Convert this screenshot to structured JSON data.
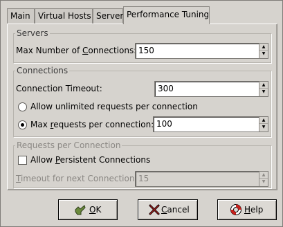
{
  "tabs": [
    "Main",
    "Virtual Hosts",
    "Server",
    "Performance Tuning"
  ],
  "servers": {
    "title": "Servers",
    "max_connections_label_pre": "Max Number of ",
    "max_connections_label_ul": "C",
    "max_connections_label_post": "onnections:",
    "max_connections_value": "150"
  },
  "connections": {
    "title": "Connections",
    "timeout_label": "Connection Timeout:",
    "timeout_value": "300",
    "unlimited_label": "Allow unlimited requests per connection",
    "max_requests_label_pre": "Max ",
    "max_requests_label_ul": "r",
    "max_requests_label_post": "equests per connection:",
    "max_requests_value": "100"
  },
  "requests": {
    "title": "Requests per Connection",
    "persistent_label_pre": "Allow ",
    "persistent_label_ul": "P",
    "persistent_label_post": "ersistent Connections",
    "timeout_next_label_ul": "T",
    "timeout_next_label_post": "imeout for next Connection:",
    "timeout_next_value": "15"
  },
  "buttons": {
    "ok_ul": "O",
    "ok_post": "K",
    "cancel_ul": "C",
    "cancel_post": "ancel",
    "help_ul": "H",
    "help_post": "elp"
  },
  "colors": {
    "background": "#d6d3ce",
    "disabled_text": "#8a8783"
  }
}
